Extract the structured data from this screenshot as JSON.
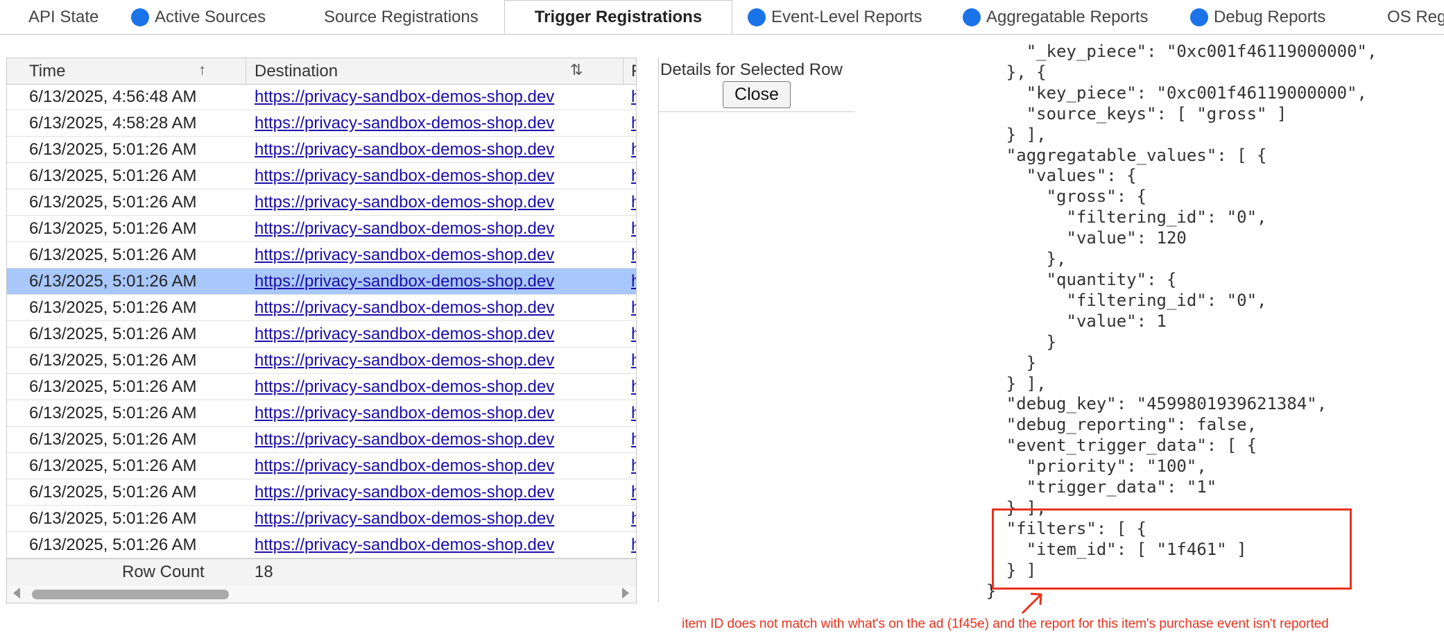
{
  "tabs": [
    {
      "label": "API State",
      "has_dot": false,
      "active": false
    },
    {
      "label": "Active Sources",
      "has_dot": true,
      "active": false
    },
    {
      "label": "Source Registrations",
      "has_dot": false,
      "active": false
    },
    {
      "label": "Trigger Registrations",
      "has_dot": false,
      "active": true
    },
    {
      "label": "Event-Level Reports",
      "has_dot": true,
      "active": false
    },
    {
      "label": "Aggregatable Reports",
      "has_dot": true,
      "active": false
    },
    {
      "label": "Debug Reports",
      "has_dot": true,
      "active": false
    },
    {
      "label": "OS Reg",
      "has_dot": false,
      "active": false
    }
  ],
  "table": {
    "columns": {
      "time": "Time",
      "destination": "Destination",
      "third": "F"
    },
    "rows": [
      {
        "time": "6/13/2025, 4:56:48 AM",
        "destination": "https://privacy-sandbox-demos-shop.dev",
        "extra": "h",
        "selected": false
      },
      {
        "time": "6/13/2025, 4:58:28 AM",
        "destination": "https://privacy-sandbox-demos-shop.dev",
        "extra": "h",
        "selected": false
      },
      {
        "time": "6/13/2025, 5:01:26 AM",
        "destination": "https://privacy-sandbox-demos-shop.dev",
        "extra": "h",
        "selected": false
      },
      {
        "time": "6/13/2025, 5:01:26 AM",
        "destination": "https://privacy-sandbox-demos-shop.dev",
        "extra": "h",
        "selected": false
      },
      {
        "time": "6/13/2025, 5:01:26 AM",
        "destination": "https://privacy-sandbox-demos-shop.dev",
        "extra": "h",
        "selected": false
      },
      {
        "time": "6/13/2025, 5:01:26 AM",
        "destination": "https://privacy-sandbox-demos-shop.dev",
        "extra": "h",
        "selected": false
      },
      {
        "time": "6/13/2025, 5:01:26 AM",
        "destination": "https://privacy-sandbox-demos-shop.dev",
        "extra": "h",
        "selected": false
      },
      {
        "time": "6/13/2025, 5:01:26 AM",
        "destination": "https://privacy-sandbox-demos-shop.dev",
        "extra": "h",
        "selected": true
      },
      {
        "time": "6/13/2025, 5:01:26 AM",
        "destination": "https://privacy-sandbox-demos-shop.dev",
        "extra": "h",
        "selected": false
      },
      {
        "time": "6/13/2025, 5:01:26 AM",
        "destination": "https://privacy-sandbox-demos-shop.dev",
        "extra": "h",
        "selected": false
      },
      {
        "time": "6/13/2025, 5:01:26 AM",
        "destination": "https://privacy-sandbox-demos-shop.dev",
        "extra": "h",
        "selected": false
      },
      {
        "time": "6/13/2025, 5:01:26 AM",
        "destination": "https://privacy-sandbox-demos-shop.dev",
        "extra": "h",
        "selected": false
      },
      {
        "time": "6/13/2025, 5:01:26 AM",
        "destination": "https://privacy-sandbox-demos-shop.dev",
        "extra": "h",
        "selected": false
      },
      {
        "time": "6/13/2025, 5:01:26 AM",
        "destination": "https://privacy-sandbox-demos-shop.dev",
        "extra": "h",
        "selected": false
      },
      {
        "time": "6/13/2025, 5:01:26 AM",
        "destination": "https://privacy-sandbox-demos-shop.dev",
        "extra": "h",
        "selected": false
      },
      {
        "time": "6/13/2025, 5:01:26 AM",
        "destination": "https://privacy-sandbox-demos-shop.dev",
        "extra": "h",
        "selected": false
      },
      {
        "time": "6/13/2025, 5:01:26 AM",
        "destination": "https://privacy-sandbox-demos-shop.dev",
        "extra": "h",
        "selected": false
      },
      {
        "time": "6/13/2025, 5:01:26 AM",
        "destination": "https://privacy-sandbox-demos-shop.dev",
        "extra": "h",
        "selected": false
      }
    ],
    "footer": {
      "label": "Row Count",
      "value": "18"
    }
  },
  "details": {
    "title": "Details for Selected Row",
    "close_label": "Close"
  },
  "json_lines": [
    "      \"_key_piece\": \"0xc001f46119000000\",",
    "    }, {",
    "      \"key_piece\": \"0xc001f46119000000\",",
    "      \"source_keys\": [ \"gross\" ]",
    "    } ],",
    "    \"aggregatable_values\": [ {",
    "      \"values\": {",
    "        \"gross\": {",
    "          \"filtering_id\": \"0\",",
    "          \"value\": 120",
    "        },",
    "        \"quantity\": {",
    "          \"filtering_id\": \"0\",",
    "          \"value\": 1",
    "        }",
    "      }",
    "    } ],",
    "    \"debug_key\": \"4599801939621384\",",
    "    \"debug_reporting\": false,",
    "    \"event_trigger_data\": [ {",
    "      \"priority\": \"100\",",
    "      \"trigger_data\": \"1\"",
    "    } ],",
    "    \"filters\": [ {",
    "      \"item_id\": [ \"1f461\" ]",
    "    } ]",
    "  }"
  ],
  "annotation": {
    "text": "item ID does not match with what's on the ad (1f45e) and the report for this item's purchase event isn't reported",
    "color": "#e8321e"
  },
  "colors": {
    "accent_dot": "#1a73e8",
    "selected_row": "#a8c7fa",
    "link": "#1a0dab"
  }
}
